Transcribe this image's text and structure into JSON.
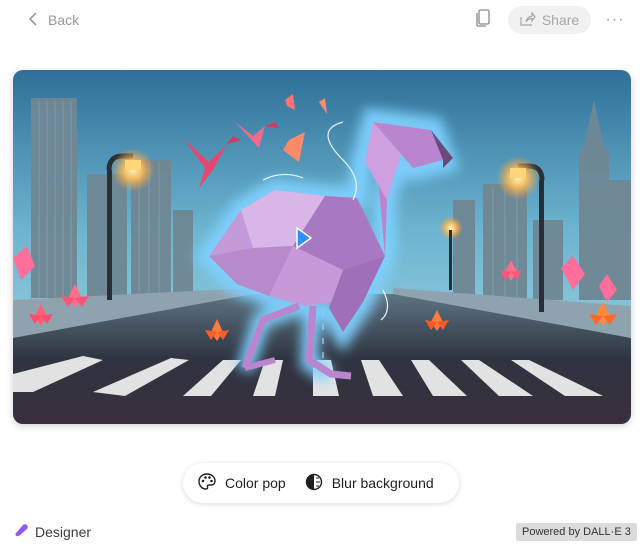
{
  "header": {
    "back_label": "Back",
    "share_label": "Share",
    "icons": {
      "back": "chevron-left-icon",
      "copy": "copy-icon",
      "share": "share-icon",
      "more": "more-icon"
    }
  },
  "image": {
    "alt": "Origami flamingo on a crosswalk between city buildings",
    "effect": "Color pop",
    "accent_colors": {
      "glow": "#7fd0ff",
      "flamingo": "#c58fd8",
      "flower": "#ff5a3c"
    }
  },
  "actions": [
    {
      "label": "Color pop",
      "icon": "palette-icon"
    },
    {
      "label": "Blur background",
      "icon": "half-circle-icon"
    }
  ],
  "footer": {
    "brand": "Designer",
    "powered_by": "Powered by DALL·E 3"
  }
}
